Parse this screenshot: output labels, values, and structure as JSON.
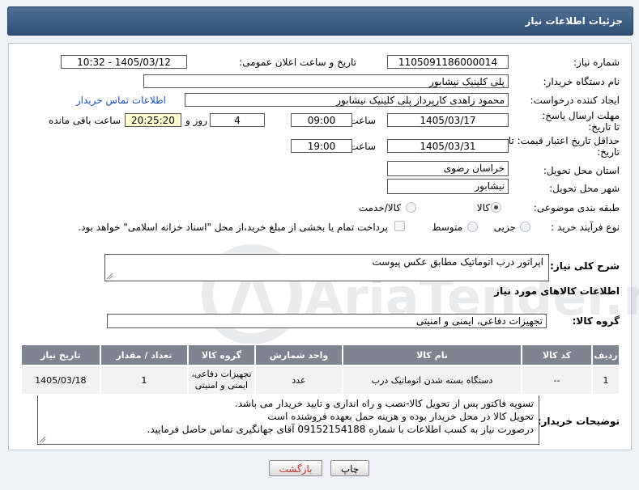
{
  "header": {
    "title": "جزئیات اطلاعات نیاز"
  },
  "form": {
    "need_number": {
      "label": "شماره نیاز:",
      "value": "1105091186000014"
    },
    "announce": {
      "label": "تاریخ و ساعت اعلان عمومی:",
      "value": "1405/03/12 - 10:32"
    },
    "buyer_org": {
      "label": "نام دستگاه خریدار:",
      "value": "پلی کلینیک نیشابور"
    },
    "requester": {
      "label": "ایجاد کننده درخواست:",
      "value": "محمود زاهدی کارپرداز پلی کلینیک نیشابور",
      "contact_link": "اطلاعات تماس خریدار"
    },
    "deadline": {
      "label": "مهلت ارسال پاسخ: تا تاریخ:",
      "date": "1405/03/17",
      "time_label": "ساعت",
      "time": "09:00",
      "days": "4",
      "days_label": "روز و",
      "remaining": "20:25:20",
      "remaining_label": "ساعت باقی مانده"
    },
    "validity": {
      "label": "حداقل تاریخ اعتبار قیمت: تا تاریخ:",
      "date": "1405/03/31",
      "time_label": "ساعت",
      "time": "19:00"
    },
    "province": {
      "label": "استان محل تحویل:",
      "value": "خراسان رضوی"
    },
    "city": {
      "label": "شهر محل تحویل:",
      "value": "نیشابور"
    },
    "category": {
      "label": "طبقه بندی موضوعی:",
      "opt_goods": "کالا",
      "opt_goods_service": "کالا/خدمت",
      "selected": "کالا"
    },
    "process": {
      "label": "نوع فرآیند خرید :",
      "opt_partial": "جزیی",
      "opt_medium": "متوسط",
      "payment_note": "پرداخت تمام یا بخشی از مبلغ خرید،از محل \"اسناد خزانه اسلامی\" خواهد بود."
    },
    "summary": {
      "label": "شرح کلی نیاز:",
      "value": "اپراتور درب اتوماتیک مطابق عکس پیوست"
    },
    "goods_info_title": "اطلاعات کالاهای مورد نیاز",
    "goods_group": {
      "label": "گروه کالا:",
      "value": "تجهیزات دفاعی، ایمنی و امنیتی"
    }
  },
  "table": {
    "headers": [
      "ردیف",
      "کد کالا",
      "نام کالا",
      "واحد شمارش",
      "گروه کالا",
      "تعداد / مقدار",
      "تاریخ نیاز"
    ],
    "rows": [
      [
        "1",
        "--",
        "دستگاه بسته شدن اتوماتیک درب",
        "عدد",
        "تجهیزات دفاعی، ایمنی و امنیتی",
        "1",
        "1405/03/18"
      ]
    ]
  },
  "buyer_notes": {
    "label": "توضیحات خریدار:",
    "lines": [
      "تسویه فاکتور پس از تحویل کالا-نصب و راه اندازی و تایید خریدار می باشد.",
      "تحویل کالا در محل خریدار بوده و هزینه حمل بعهده فروشنده است",
      "درصورت نیاز به کسب اطلاعات با شماره 09152154188 آقای جهانگیری تماس حاصل فرمایید."
    ]
  },
  "buttons": {
    "print": "چاپ",
    "back": "بازگشت"
  },
  "watermark": "AriaTender.net"
}
